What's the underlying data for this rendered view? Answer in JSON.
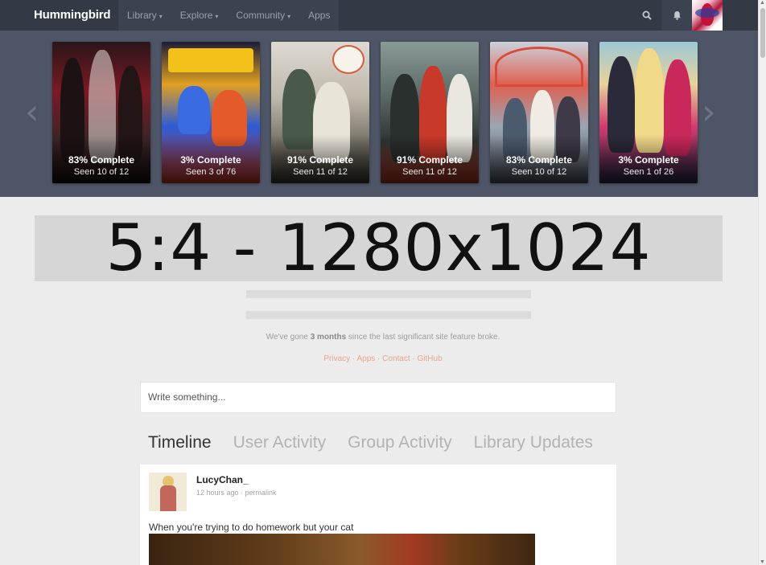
{
  "navbar": {
    "brand": "Hummingbird",
    "menu": [
      {
        "label": "Library",
        "caret": "▾"
      },
      {
        "label": "Explore",
        "caret": "▾"
      },
      {
        "label": "Community",
        "caret": "▾"
      },
      {
        "label": "Apps",
        "caret": ""
      }
    ]
  },
  "carousel": {
    "cards": [
      {
        "progress": "83% Complete",
        "seen": "Seen 10 of 12",
        "bg": "linear-gradient(180deg,#2a1518 0%,#7a1a24 35%,#3b2427 70%,#1a0f10 100%)"
      },
      {
        "progress": "3% Complete",
        "seen": "Seen 3 of 76",
        "bg": "linear-gradient(180deg,#1c1c3a 0%,#e0a020 30%,#2d5bd4 60%,#d03a2a 100%)"
      },
      {
        "progress": "91% Complete",
        "seen": "Seen 11 of 12",
        "bg": "linear-gradient(180deg,#dedad2 0%,#bfb8aa 40%,#6e6a5e 75%,#3a3a32 100%)"
      },
      {
        "progress": "91% Complete",
        "seen": "Seen 11 of 12",
        "bg": "linear-gradient(180deg,#8a9a96 0%,#5f6e6a 35%,#2f3634 70%,#b33a2a 100%)"
      },
      {
        "progress": "83% Complete",
        "seen": "Seen 10 of 12",
        "bg": "linear-gradient(180deg,#c9d2dc 0%,#e06050 30%,#9aa6b3 60%,#4e5560 100%)"
      },
      {
        "progress": "3% Complete",
        "seen": "Seen 1 of 26",
        "bg": "linear-gradient(180deg,#9cc8d6 0%,#e8d39a 30%,#d23a6e 60%,#2b2b45 100%)"
      }
    ]
  },
  "banner": {
    "text": "5:4 - 1280x1024"
  },
  "footer": {
    "note_prefix": "We've gone ",
    "note_bold": "3 months",
    "note_suffix": " since the last significant site feature broke.",
    "links": [
      {
        "label": "Privacy"
      },
      {
        "label": "Apps"
      },
      {
        "label": "Contact"
      },
      {
        "label": "GitHub"
      }
    ],
    "separator": " · "
  },
  "composer": {
    "placeholder": "Write something..."
  },
  "tabs": [
    {
      "label": "Timeline",
      "active": true
    },
    {
      "label": "User Activity",
      "active": false
    },
    {
      "label": "Group Activity",
      "active": false
    },
    {
      "label": "Library Updates",
      "active": false
    }
  ],
  "post": {
    "username": "LucyChan_",
    "time": "12 hours ago",
    "meta_sep": " · ",
    "permalink": "permalink",
    "text": "When you're trying to do homework but your cat"
  }
}
